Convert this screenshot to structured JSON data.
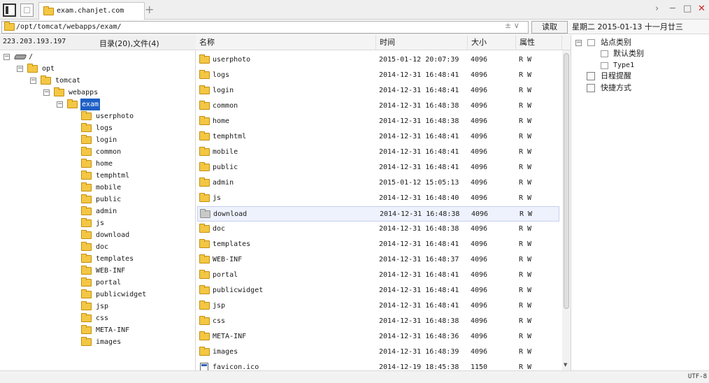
{
  "tab": {
    "title": "exam.chanjet.com"
  },
  "toolbar": {
    "new_tab": "+",
    "read_label": "读取",
    "path_controls": "± ∨"
  },
  "window": {
    "forward": "›",
    "minimize": "─",
    "maximize": "□",
    "close": "✕"
  },
  "path": {
    "value": "/opt/tomcat/webapps/exam/"
  },
  "date_bar": "星期二 2015-01-13 十一月廿三",
  "server": {
    "ip": "223.203.193.197",
    "summary": "目录(20),文件(4)"
  },
  "tree": {
    "root": "/",
    "opt": "opt",
    "tomcat": "tomcat",
    "webapps": "webapps",
    "selected": "exam",
    "children": [
      "userphoto",
      "logs",
      "login",
      "common",
      "home",
      "temphtml",
      "mobile",
      "public",
      "admin",
      "js",
      "download",
      "doc",
      "templates",
      "WEB-INF",
      "portal",
      "publicwidget",
      "jsp",
      "css",
      "META-INF",
      "images"
    ]
  },
  "columns": {
    "name": "名称",
    "time": "时间",
    "size": "大小",
    "attr": "属性"
  },
  "files": [
    {
      "name": "userphoto",
      "time": "2015-01-12 20:07:39",
      "size": "4096",
      "attr": "R W"
    },
    {
      "name": "logs",
      "time": "2014-12-31 16:48:41",
      "size": "4096",
      "attr": "R W"
    },
    {
      "name": "login",
      "time": "2014-12-31 16:48:41",
      "size": "4096",
      "attr": "R W"
    },
    {
      "name": "common",
      "time": "2014-12-31 16:48:38",
      "size": "4096",
      "attr": "R W"
    },
    {
      "name": "home",
      "time": "2014-12-31 16:48:38",
      "size": "4096",
      "attr": "R W"
    },
    {
      "name": "temphtml",
      "time": "2014-12-31 16:48:41",
      "size": "4096",
      "attr": "R W"
    },
    {
      "name": "mobile",
      "time": "2014-12-31 16:48:41",
      "size": "4096",
      "attr": "R W"
    },
    {
      "name": "public",
      "time": "2014-12-31 16:48:41",
      "size": "4096",
      "attr": "R W"
    },
    {
      "name": "admin",
      "time": "2015-01-12 15:05:13",
      "size": "4096",
      "attr": "R W"
    },
    {
      "name": "js",
      "time": "2014-12-31 16:48:40",
      "size": "4096",
      "attr": "R W"
    },
    {
      "name": "download",
      "time": "2014-12-31 16:48:38",
      "size": "4096",
      "attr": "R W"
    },
    {
      "name": "doc",
      "time": "2014-12-31 16:48:38",
      "size": "4096",
      "attr": "R W"
    },
    {
      "name": "templates",
      "time": "2014-12-31 16:48:41",
      "size": "4096",
      "attr": "R W"
    },
    {
      "name": "WEB-INF",
      "time": "2014-12-31 16:48:37",
      "size": "4096",
      "attr": "R W"
    },
    {
      "name": "portal",
      "time": "2014-12-31 16:48:41",
      "size": "4096",
      "attr": "R W"
    },
    {
      "name": "publicwidget",
      "time": "2014-12-31 16:48:41",
      "size": "4096",
      "attr": "R W"
    },
    {
      "name": "jsp",
      "time": "2014-12-31 16:48:41",
      "size": "4096",
      "attr": "R W"
    },
    {
      "name": "css",
      "time": "2014-12-31 16:48:38",
      "size": "4096",
      "attr": "R W"
    },
    {
      "name": "META-INF",
      "time": "2014-12-31 16:48:36",
      "size": "4096",
      "attr": "R W"
    },
    {
      "name": "images",
      "time": "2014-12-31 16:48:39",
      "size": "4096",
      "attr": "R W"
    },
    {
      "name": "favicon.ico",
      "time": "2014-12-19 18:45:38",
      "size": "1150",
      "attr": "R W"
    }
  ],
  "side_tree": {
    "site_category": "站点类别",
    "default_category": "默认类别",
    "type1": "Type1",
    "reminder": "日程提醒",
    "shortcut": "快捷方式"
  },
  "status": {
    "encoding": "UTF-8"
  }
}
